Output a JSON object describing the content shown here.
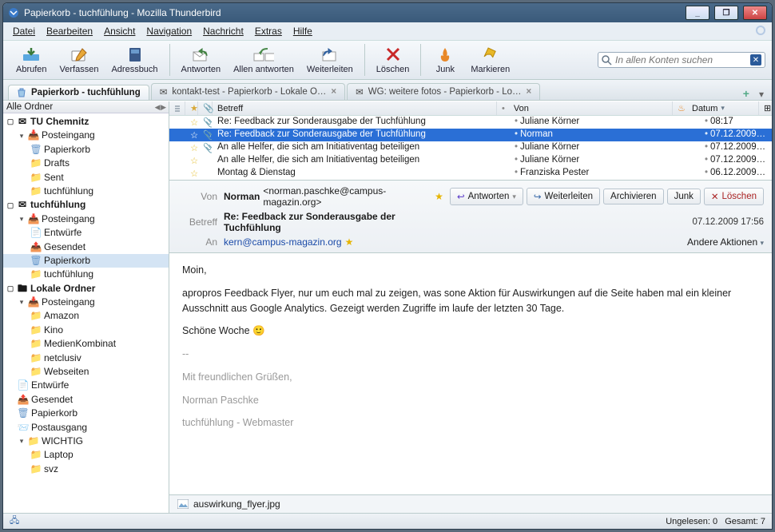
{
  "window": {
    "title": "Papierkorb - tuchfühlung - Mozilla Thunderbird"
  },
  "menu": [
    "Datei",
    "Bearbeiten",
    "Ansicht",
    "Navigation",
    "Nachricht",
    "Extras",
    "Hilfe"
  ],
  "toolbar": {
    "abrufen": "Abrufen",
    "verfassen": "Verfassen",
    "adressbuch": "Adressbuch",
    "antworten": "Antworten",
    "allen_antworten": "Allen antworten",
    "weiterleiten": "Weiterleiten",
    "loeschen": "Löschen",
    "junk": "Junk",
    "markieren": "Markieren"
  },
  "search": {
    "placeholder": "In allen Konten suchen"
  },
  "tabs": [
    {
      "label": "Papierkorb - tuchfühlung",
      "icon": "trash",
      "active": true
    },
    {
      "label": "kontakt-test - Papierkorb - Lokale O…",
      "icon": "mail",
      "active": false
    },
    {
      "label": "WG: weitere fotos - Papierkorb - Lo…",
      "icon": "mail",
      "active": false
    }
  ],
  "foldertoolbar": {
    "label": "Alle Ordner"
  },
  "tree": {
    "acct1": "TU Chemnitz",
    "a1_inbox": "Posteingang",
    "a1_trash": "Papierkorb",
    "a1_drafts": "Drafts",
    "a1_sent": "Sent",
    "a1_tuch": "tuchfühlung",
    "acct2": "tuchfühlung",
    "a2_inbox": "Posteingang",
    "a2_drafts": "Entwürfe",
    "a2_sent": "Gesendet",
    "a2_trash": "Papierkorb",
    "a2_tuch": "tuchfühlung",
    "acct3": "Lokale Ordner",
    "a3_inbox": "Posteingang",
    "a3_amazon": "Amazon",
    "a3_kino": "Kino",
    "a3_medien": "MedienKombinat",
    "a3_netclusiv": "netclusiv",
    "a3_webseiten": "Webseiten",
    "a3_drafts": "Entwürfe",
    "a3_sent": "Gesendet",
    "a3_trash": "Papierkorb",
    "a3_outbox": "Postausgang",
    "a3_wichtig": "WICHTIG",
    "a3_laptop": "Laptop",
    "a3_svz": "svz"
  },
  "columns": {
    "subject": "Betreff",
    "from": "Von",
    "date": "Datum"
  },
  "messages": [
    {
      "star": "☆",
      "attach": "📎",
      "subject": "Re: Feedback zur Sonderausgabe der Tuchfühlung",
      "from": "Juliane Körner",
      "date": "08:17",
      "selected": false
    },
    {
      "star": "☆",
      "attach": "📎",
      "subject": "Re: Feedback zur Sonderausgabe der Tuchfühlung",
      "from": "Norman",
      "date": "07.12.2009 1…",
      "selected": true
    },
    {
      "star": "☆",
      "attach": "📎",
      "subject": "An alle Helfer, die sich am Initiativentag beteiligen",
      "from": "Juliane Körner",
      "date": "07.12.2009 0…",
      "selected": false
    },
    {
      "star": "☆",
      "attach": "",
      "subject": "An alle Helfer, die sich am Initiativentag beteiligen",
      "from": "Juliane Körner",
      "date": "07.12.2009 0…",
      "selected": false
    },
    {
      "star": "☆",
      "attach": "",
      "subject": "Montag & Dienstag",
      "from": "Franziska Pester",
      "date": "06.12.2009 1…",
      "selected": false
    }
  ],
  "preview": {
    "from_label": "Von",
    "from_name": "Norman",
    "from_email": "<norman.paschke@campus-magazin.org>",
    "subject_label": "Betreff",
    "subject": "Re: Feedback zur Sonderausgabe der Tuchfühlung",
    "to_label": "An",
    "to": "kern@campus-magazin.org",
    "date": "07.12.2009 17:56",
    "other_actions": "Andere Aktionen",
    "btn_reply": "Antworten",
    "btn_forward": "Weiterleiten",
    "btn_archive": "Archivieren",
    "btn_junk": "Junk",
    "btn_delete": "Löschen",
    "body_line1": "Moin,",
    "body_line2": "apropros Feedback Flyer, nur um euch mal zu zeigen, was sone Aktion für Auswirkungen auf die Seite haben mal ein kleiner Ausschnitt aus Google Analytics. Gezeigt werden Zugriffe im laufe der letzten 30 Tage.",
    "body_line3": "Schöne Woche 🙂",
    "sig_divider": "--",
    "sig1": "Mit freundlichen Grüßen,",
    "sig2": "Norman Paschke",
    "sig3": "tuchfühlung - Webmaster",
    "attachment": "auswirkung_flyer.jpg"
  },
  "status": {
    "unread_label": "Ungelesen:",
    "unread": "0",
    "total_label": "Gesamt:",
    "total": "7"
  }
}
